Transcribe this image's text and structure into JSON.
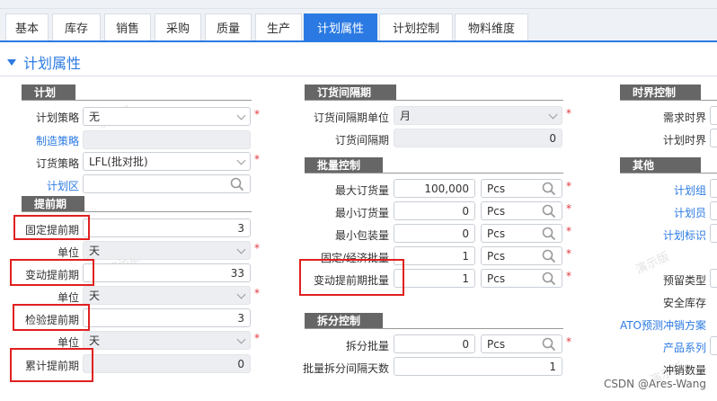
{
  "tabs": [
    "基本",
    "库存",
    "销售",
    "采购",
    "质量",
    "生产",
    "计划属性",
    "计划控制",
    "物料维度"
  ],
  "section_title": "计划属性",
  "watermark": "演示版",
  "plan": {
    "title": "计划",
    "strategy_label": "计划策略",
    "strategy_value": "无",
    "make_strategy_label": "制造策略",
    "order_strategy_label": "订货策略",
    "order_strategy_value": "LFL(批对批)",
    "plan_zone_label": "计划区"
  },
  "lead": {
    "title": "提前期",
    "fixed_label": "固定提前期",
    "fixed_value": "3",
    "unit_label": "单位",
    "unit_value": "天",
    "variable_label": "变动提前期",
    "variable_value": "33",
    "inspect_label": "检验提前期",
    "inspect_value": "3",
    "cumulative_label": "累计提前期",
    "cumulative_value": "0"
  },
  "interval": {
    "title": "订货间隔期",
    "unit_label": "订货间隔期单位",
    "unit_value": "月",
    "period_label": "订货间隔期",
    "period_value": "0"
  },
  "batch": {
    "title": "批量控制",
    "unit": "Pcs",
    "max_label": "最大订货量",
    "max_value": "100,000",
    "min_label": "最小订货量",
    "min_value": "0",
    "pack_label": "最小包装量",
    "pack_value": "0",
    "eco_label": "固定/经济批量",
    "eco_value": "1",
    "lead_label": "变动提前期批量",
    "lead_value": "1"
  },
  "split": {
    "title": "拆分控制",
    "qty_label": "拆分批量",
    "qty_value": "0",
    "days_label": "批量拆分间隔天数",
    "days_value": "1"
  },
  "fence": {
    "title": "时界控制",
    "demand_label": "需求时界",
    "plan_label": "计划时界"
  },
  "other": {
    "title": "其他",
    "group_label": "计划组",
    "planner_label": "计划员",
    "mark_label": "计划标识",
    "reserve_label": "预留类型",
    "safety_label": "安全库存",
    "ato_label": "ATO预测冲销方案",
    "series_label": "产品系列",
    "offset_label": "冲销数量"
  },
  "footer": "CSDN @Ares-Wang",
  "colors": {
    "accent": "#2b7ae3",
    "required": "#e0393e",
    "highlight": "#e02020"
  }
}
